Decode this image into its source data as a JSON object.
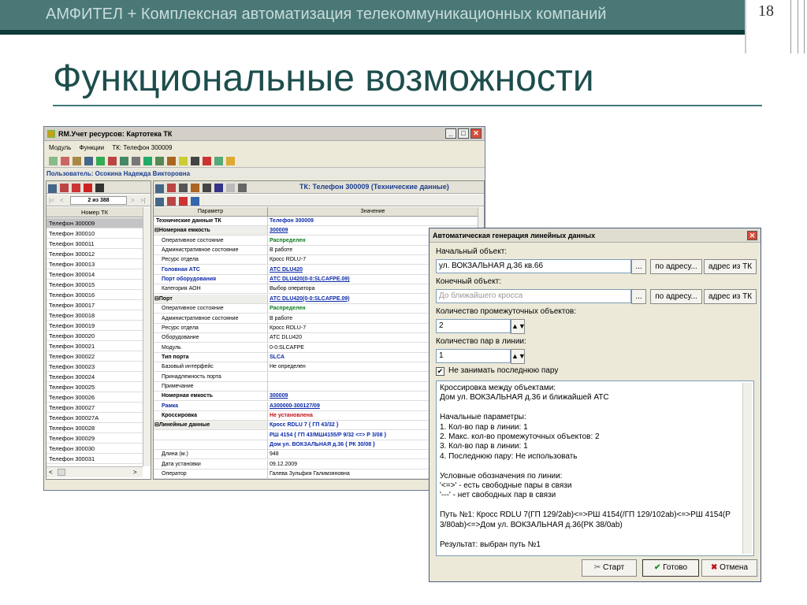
{
  "slide": {
    "header": "АМФИТЕЛ + Комплексная автоматизация телекоммуникационных компаний",
    "page_number": "18",
    "title": "Функциональные возможности"
  },
  "main_window": {
    "title": "RM.Учет ресурсов: Картотека ТК",
    "menu": [
      "Модуль",
      "Функции",
      "ТК: Телефон 300009"
    ],
    "user_label": "Пользователь: Осокина Надежда Викторовна",
    "record_panel_title": "ТК: Телефон 300009 (Технические данные)",
    "pager": "2 из 388",
    "list_header": "Номер ТК",
    "list_items": [
      "Телефон 300009",
      "Телефон 300010",
      "Телефон 300011",
      "Телефон 300012",
      "Телефон 300013",
      "Телефон 300014",
      "Телефон 300015",
      "Телефон 300016",
      "Телефон 300017",
      "Телефон 300018",
      "Телефон 300019",
      "Телефон 300020",
      "Телефон 300021",
      "Телефон 300022",
      "Телефон 300023",
      "Телефон 300024",
      "Телефон 300025",
      "Телефон 300026",
      "Телефон 300027",
      "Телефон 300027А",
      "Телефон 300028",
      "Телефон 300029",
      "Телефон 300030",
      "Телефон 300031"
    ],
    "grid_headers": [
      "Параметр",
      "Значение"
    ],
    "grid_rows": [
      {
        "p": "Технические данные ТК",
        "v": "Телефон 300009",
        "ps": "bold",
        "vs": "bl"
      },
      {
        "p": "⊟Номерная емкость",
        "v": "300009",
        "ps": "bold",
        "vs": "bl ul"
      },
      {
        "p": "Оперативное состояние",
        "v": "Распределен",
        "ps": "",
        "vs": "gr"
      },
      {
        "p": "Административное состояние",
        "v": "В работе",
        "ps": "",
        "vs": ""
      },
      {
        "p": "Ресурс отдела",
        "v": "Кросс RDLU-7",
        "ps": "",
        "vs": ""
      },
      {
        "p": "Головная АТС",
        "v": "АТС DLU420",
        "ps": "bl",
        "vs": "bl ul"
      },
      {
        "p": "Порт оборудования",
        "v": "АТС DLU420(0-0:SLCAFPE.09)",
        "ps": "bl",
        "vs": "bl ul"
      },
      {
        "p": "Категория АОН",
        "v": "Выбор оператора",
        "ps": "",
        "vs": ""
      },
      {
        "p": "⊟Порт",
        "v": "АТС DLU420(0-0:SLCAFPE.09)",
        "ps": "bold",
        "vs": "bl ul"
      },
      {
        "p": "Оперативное состояние",
        "v": "Распределен",
        "ps": "",
        "vs": "gr"
      },
      {
        "p": "Административное состояние",
        "v": "В работе",
        "ps": "",
        "vs": ""
      },
      {
        "p": "Ресурс отдела",
        "v": "Кросс RDLU-7",
        "ps": "",
        "vs": ""
      },
      {
        "p": "Оборудование",
        "v": "АТС DLU420",
        "ps": "",
        "vs": ""
      },
      {
        "p": "Модуль",
        "v": "0-0:SLCAFPE",
        "ps": "",
        "vs": ""
      },
      {
        "p": "Тип порта",
        "v": "SLCA",
        "ps": "bold",
        "vs": "bl"
      },
      {
        "p": "Базовый интерфейс",
        "v": "Не определен",
        "ps": "",
        "vs": ""
      },
      {
        "p": "Принадлежность порта",
        "v": "",
        "ps": "",
        "vs": ""
      },
      {
        "p": "Примечание",
        "v": "",
        "ps": "",
        "vs": ""
      },
      {
        "p": "Номерная емкость",
        "v": "300009",
        "ps": "bold",
        "vs": "bl ul"
      },
      {
        "p": "Рамка",
        "v": "А300000-300127/09",
        "ps": "bl",
        "vs": "bl ul"
      },
      {
        "p": "Кроссировка",
        "v": "Не установлена",
        "ps": "bold",
        "vs": "rd"
      },
      {
        "p": "⊟Линейные данные",
        "v": "Кросс RDLU 7 { ГП 43/32 }",
        "ps": "bold",
        "vs": "bl"
      },
      {
        "p": "",
        "v": "РШ 4154 { ГП 43/МШ4155/Р 9/32 <=> Р 3/08 }",
        "ps": "",
        "vs": "bl"
      },
      {
        "p": "",
        "v": "Дом ул. ВОКЗАЛЬНАЯ д.36 { РК 30/08 }",
        "ps": "",
        "vs": "bl"
      },
      {
        "p": "Длина (м.)",
        "v": "948",
        "ps": "",
        "vs": ""
      },
      {
        "p": "Дата установки",
        "v": "09.12.2009",
        "ps": "",
        "vs": ""
      },
      {
        "p": "Оператор",
        "v": "Галева Зульфия Галимзяновна",
        "ps": "",
        "vs": ""
      }
    ]
  },
  "dialog": {
    "title": "Автоматическая генерация линейных данных",
    "start_label": "Начальный объект:",
    "start_value": "ул. ВОКЗАЛЬНАЯ д.36 кв.66",
    "end_label": "Конечный объект:",
    "end_placeholder": "До ближайшего кросса",
    "by_address": "по адресу...",
    "address_from_tk": "адрес из ТК",
    "ellipsis": "...",
    "intermediate_label": "Количество промежуточных объектов:",
    "intermediate_value": "2",
    "pairs_label": "Количество пар в линии:",
    "pairs_value": "1",
    "checkbox_label": "Не занимать последнюю пару",
    "checkbox_checked": true,
    "memo": "Кроссировка между объектами:\nДом ул. ВОКЗАЛЬНАЯ д.36 и ближайшей АТС\n\nНачальные параметры:\n1. Кол-во пар в линии: 1\n2. Макс. кол-во промежуточных объектов: 2\n3. Кол-во пар в линии: 1\n4. Последнюю пару: Не использовать\n\nУсловные обозначения по линии:\n'<=>' - есть свободные пары в связи\n'---' - нет свободных пар в связи\n\nПуть №1: Кросс RDLU 7(ГП 129/2ab)<=>РШ 4154(/ГП 129/102ab)<=>РШ 4154(Р\n3/80ab)<=>Дом ул. ВОКЗАЛЬНАЯ д.36(РК 38/0ab)\n\nРезультат: выбран путь №1",
    "btn_start": "Старт",
    "btn_ok": "Готово",
    "btn_cancel": "Отмена"
  }
}
